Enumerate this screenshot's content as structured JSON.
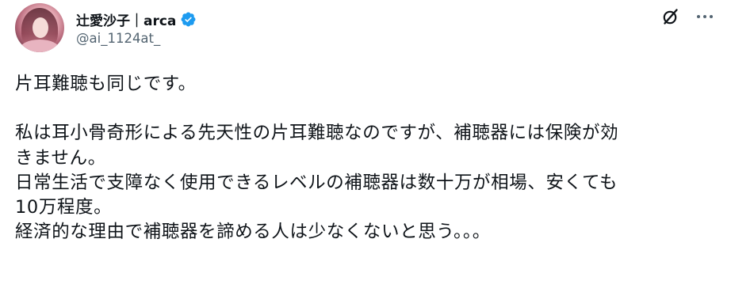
{
  "author": {
    "display_name": "辻愛沙子｜arca",
    "handle": "@ai_1124at_",
    "verified": true
  },
  "icons": {
    "verified": "verified-badge-icon",
    "grok": "grok-icon",
    "more": "more-options-icon"
  },
  "colors": {
    "verified": "#1d9bf0",
    "text": "#0f1419",
    "handle": "#536471"
  },
  "post": {
    "lines": [
      "片耳難聴も同じです。",
      "",
      "私は耳小骨奇形による先天性の片耳難聴なのですが、補聴器には保険が効",
      "きません。",
      "日常生活で支障なく使用できるレベルの補聴器は数十万が相場、安くても",
      "10万程度。",
      "経済的な理由で補聴器を諦める人は少なくないと思う。。。"
    ]
  }
}
